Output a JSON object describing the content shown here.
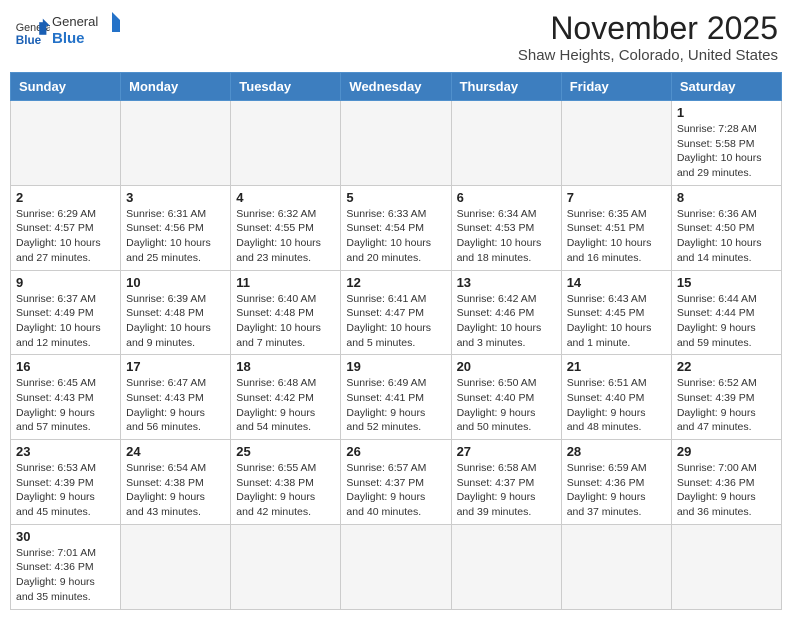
{
  "header": {
    "logo_general": "General",
    "logo_blue": "Blue",
    "month_title": "November 2025",
    "location": "Shaw Heights, Colorado, United States"
  },
  "weekdays": [
    "Sunday",
    "Monday",
    "Tuesday",
    "Wednesday",
    "Thursday",
    "Friday",
    "Saturday"
  ],
  "weeks": [
    [
      {
        "day": "",
        "info": ""
      },
      {
        "day": "",
        "info": ""
      },
      {
        "day": "",
        "info": ""
      },
      {
        "day": "",
        "info": ""
      },
      {
        "day": "",
        "info": ""
      },
      {
        "day": "",
        "info": ""
      },
      {
        "day": "1",
        "info": "Sunrise: 7:28 AM\nSunset: 5:58 PM\nDaylight: 10 hours and 29 minutes."
      }
    ],
    [
      {
        "day": "2",
        "info": "Sunrise: 6:29 AM\nSunset: 4:57 PM\nDaylight: 10 hours and 27 minutes."
      },
      {
        "day": "3",
        "info": "Sunrise: 6:31 AM\nSunset: 4:56 PM\nDaylight: 10 hours and 25 minutes."
      },
      {
        "day": "4",
        "info": "Sunrise: 6:32 AM\nSunset: 4:55 PM\nDaylight: 10 hours and 23 minutes."
      },
      {
        "day": "5",
        "info": "Sunrise: 6:33 AM\nSunset: 4:54 PM\nDaylight: 10 hours and 20 minutes."
      },
      {
        "day": "6",
        "info": "Sunrise: 6:34 AM\nSunset: 4:53 PM\nDaylight: 10 hours and 18 minutes."
      },
      {
        "day": "7",
        "info": "Sunrise: 6:35 AM\nSunset: 4:51 PM\nDaylight: 10 hours and 16 minutes."
      },
      {
        "day": "8",
        "info": "Sunrise: 6:36 AM\nSunset: 4:50 PM\nDaylight: 10 hours and 14 minutes."
      }
    ],
    [
      {
        "day": "9",
        "info": "Sunrise: 6:37 AM\nSunset: 4:49 PM\nDaylight: 10 hours and 12 minutes."
      },
      {
        "day": "10",
        "info": "Sunrise: 6:39 AM\nSunset: 4:48 PM\nDaylight: 10 hours and 9 minutes."
      },
      {
        "day": "11",
        "info": "Sunrise: 6:40 AM\nSunset: 4:48 PM\nDaylight: 10 hours and 7 minutes."
      },
      {
        "day": "12",
        "info": "Sunrise: 6:41 AM\nSunset: 4:47 PM\nDaylight: 10 hours and 5 minutes."
      },
      {
        "day": "13",
        "info": "Sunrise: 6:42 AM\nSunset: 4:46 PM\nDaylight: 10 hours and 3 minutes."
      },
      {
        "day": "14",
        "info": "Sunrise: 6:43 AM\nSunset: 4:45 PM\nDaylight: 10 hours and 1 minute."
      },
      {
        "day": "15",
        "info": "Sunrise: 6:44 AM\nSunset: 4:44 PM\nDaylight: 9 hours and 59 minutes."
      }
    ],
    [
      {
        "day": "16",
        "info": "Sunrise: 6:45 AM\nSunset: 4:43 PM\nDaylight: 9 hours and 57 minutes."
      },
      {
        "day": "17",
        "info": "Sunrise: 6:47 AM\nSunset: 4:43 PM\nDaylight: 9 hours and 56 minutes."
      },
      {
        "day": "18",
        "info": "Sunrise: 6:48 AM\nSunset: 4:42 PM\nDaylight: 9 hours and 54 minutes."
      },
      {
        "day": "19",
        "info": "Sunrise: 6:49 AM\nSunset: 4:41 PM\nDaylight: 9 hours and 52 minutes."
      },
      {
        "day": "20",
        "info": "Sunrise: 6:50 AM\nSunset: 4:40 PM\nDaylight: 9 hours and 50 minutes."
      },
      {
        "day": "21",
        "info": "Sunrise: 6:51 AM\nSunset: 4:40 PM\nDaylight: 9 hours and 48 minutes."
      },
      {
        "day": "22",
        "info": "Sunrise: 6:52 AM\nSunset: 4:39 PM\nDaylight: 9 hours and 47 minutes."
      }
    ],
    [
      {
        "day": "23",
        "info": "Sunrise: 6:53 AM\nSunset: 4:39 PM\nDaylight: 9 hours and 45 minutes."
      },
      {
        "day": "24",
        "info": "Sunrise: 6:54 AM\nSunset: 4:38 PM\nDaylight: 9 hours and 43 minutes."
      },
      {
        "day": "25",
        "info": "Sunrise: 6:55 AM\nSunset: 4:38 PM\nDaylight: 9 hours and 42 minutes."
      },
      {
        "day": "26",
        "info": "Sunrise: 6:57 AM\nSunset: 4:37 PM\nDaylight: 9 hours and 40 minutes."
      },
      {
        "day": "27",
        "info": "Sunrise: 6:58 AM\nSunset: 4:37 PM\nDaylight: 9 hours and 39 minutes."
      },
      {
        "day": "28",
        "info": "Sunrise: 6:59 AM\nSunset: 4:36 PM\nDaylight: 9 hours and 37 minutes."
      },
      {
        "day": "29",
        "info": "Sunrise: 7:00 AM\nSunset: 4:36 PM\nDaylight: 9 hours and 36 minutes."
      }
    ],
    [
      {
        "day": "30",
        "info": "Sunrise: 7:01 AM\nSunset: 4:36 PM\nDaylight: 9 hours and 35 minutes."
      },
      {
        "day": "",
        "info": ""
      },
      {
        "day": "",
        "info": ""
      },
      {
        "day": "",
        "info": ""
      },
      {
        "day": "",
        "info": ""
      },
      {
        "day": "",
        "info": ""
      },
      {
        "day": "",
        "info": ""
      }
    ]
  ]
}
